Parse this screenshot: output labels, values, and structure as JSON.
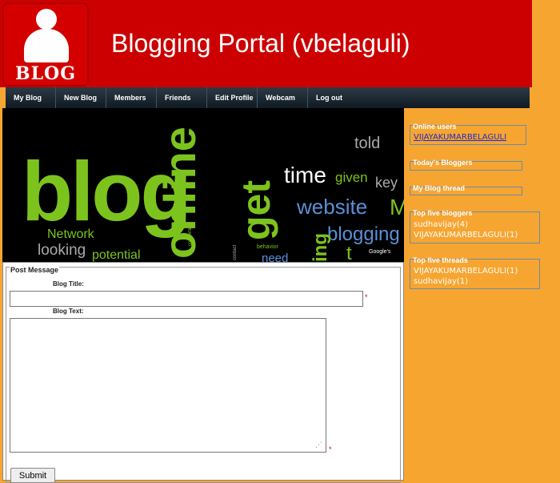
{
  "header": {
    "logo_text": "BLOG",
    "title": "Blogging Portal (vbelaguli)"
  },
  "nav": {
    "items": [
      "My Blog",
      "New Blog",
      "Members",
      "Friends",
      "Edit Profile",
      "Webcam",
      "Log out"
    ]
  },
  "hero": {
    "words": [
      "blog",
      "online",
      "get",
      "time",
      "told",
      "given",
      "key",
      "website",
      "M",
      "blogging",
      "Network",
      "looking",
      "potential",
      "converting",
      "behavior",
      "need",
      "ing",
      "Google's",
      "contact",
      "t"
    ]
  },
  "post_form": {
    "legend": "Post Message",
    "title_label": "Blog Title:",
    "text_label": "Blog Text:",
    "title_value": "",
    "text_value": "",
    "required_mark": "*",
    "submit_label": "Submit"
  },
  "sidebar": {
    "online_users": {
      "title": "Online users",
      "users": [
        "VIJAYAKUMARBELAGULI"
      ]
    },
    "todays_bloggers": {
      "title": "Today's Bloggers"
    },
    "my_blog_thread": {
      "title": "My Blog thread"
    },
    "top_bloggers": {
      "title": "Top five bloggers",
      "entries": [
        "sudhavijay(4)",
        "VIJAYAKUMARBELAGULI(1)"
      ]
    },
    "top_threads": {
      "title": "Top five threads",
      "entries": [
        "VIJAYAKUMARBELAGULI(1)",
        "sudhavijay(1)"
      ]
    }
  },
  "colors": {
    "page_bg": "#f7a531",
    "header_bg": "#cc0000",
    "nav_bg": "#1a2630",
    "hero_green": "#7dc31e",
    "hero_blue": "#5b8fd6",
    "link": "#1a2bd0"
  }
}
